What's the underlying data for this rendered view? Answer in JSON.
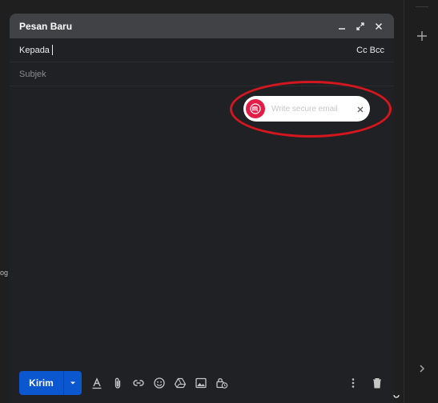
{
  "compose": {
    "title": "Pesan Baru",
    "to_label": "Kepada",
    "cc_bcc": "Cc Bcc",
    "subject_placeholder": "Subjek"
  },
  "secure_email": {
    "placeholder": "Write secure email",
    "logo_icon": "m-logo-icon",
    "brand_color": "#e11d48"
  },
  "toolbar": {
    "send_label": "Kirim",
    "accent_color": "#0b57d0",
    "icons": [
      "text-format-icon",
      "attach-icon",
      "link-icon",
      "emoji-icon",
      "drive-icon",
      "image-icon",
      "lock-clock-icon",
      "more-vert-icon",
      "trash-icon"
    ]
  },
  "edge_text": "og",
  "highlight_color": "#d4161e"
}
